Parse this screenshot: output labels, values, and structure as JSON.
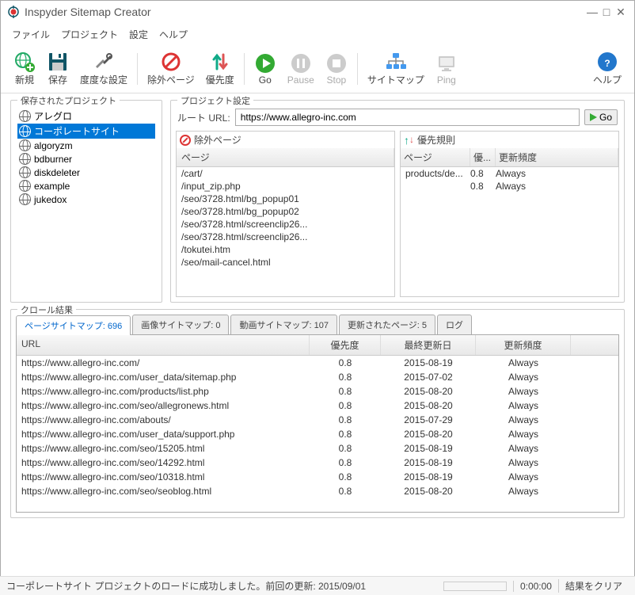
{
  "title": "Inspyder Sitemap Creator",
  "menu": {
    "file": "ファイル",
    "project": "プロジェクト",
    "settings": "設定",
    "help": "ヘルプ"
  },
  "toolbar": {
    "new": "新規",
    "save": "保存",
    "adv": "度度な設定",
    "excl": "除外ページ",
    "prio": "優先度",
    "go": "Go",
    "pause": "Pause",
    "stop": "Stop",
    "sitemap": "サイトマップ",
    "ping": "Ping",
    "help": "ヘルプ"
  },
  "saved_projects": {
    "legend": "保存されたプロジェクト",
    "items": [
      "アレグロ",
      "コーポレートサイト",
      "algoryzm",
      "bdburner",
      "diskdeleter",
      "example",
      "jukedox"
    ],
    "selected": 1
  },
  "project_settings": {
    "legend": "プロジェクト設定",
    "root_label": "ルート URL:",
    "root_url": "https://www.allegro-inc.com",
    "go": "Go",
    "excluded": {
      "title": "除外ページ",
      "col": "ページ",
      "items": [
        "/cart/",
        "/input_zip.php",
        "/seo/3728.html/bg_popup01",
        "/seo/3728.html/bg_popup02",
        "/seo/3728.html/screenclip26...",
        "/seo/3728.html/screenclip26...",
        "/tokutei.htm",
        "/seo/mail-cancel.html"
      ]
    },
    "priority": {
      "title": "優先規則",
      "cols": {
        "page": "ページ",
        "pri": "優...",
        "freq": "更新頻度"
      },
      "rows": [
        {
          "page": "products/de...",
          "pri": "0.8",
          "freq": "Always"
        },
        {
          "page": "",
          "pri": "0.8",
          "freq": "Always"
        }
      ]
    }
  },
  "crawl": {
    "legend": "クロール結果",
    "tabs": {
      "t1": "ページサイトマップ: 696",
      "t2": "画像サイトマップ: 0",
      "t3": "動画サイトマップ: 107",
      "t4": "更新されたページ: 5",
      "t5": "ログ"
    },
    "cols": {
      "url": "URL",
      "pri": "優先度",
      "date": "最終更新日",
      "freq": "更新頻度"
    },
    "rows": [
      {
        "url": "https://www.allegro-inc.com/",
        "pri": "0.8",
        "date": "2015-08-19",
        "freq": "Always"
      },
      {
        "url": "https://www.allegro-inc.com/user_data/sitemap.php",
        "pri": "0.8",
        "date": "2015-07-02",
        "freq": "Always"
      },
      {
        "url": "https://www.allegro-inc.com/products/list.php",
        "pri": "0.8",
        "date": "2015-08-20",
        "freq": "Always"
      },
      {
        "url": "https://www.allegro-inc.com/seo/allegronews.html",
        "pri": "0.8",
        "date": "2015-08-20",
        "freq": "Always"
      },
      {
        "url": "https://www.allegro-inc.com/abouts/",
        "pri": "0.8",
        "date": "2015-07-29",
        "freq": "Always"
      },
      {
        "url": "https://www.allegro-inc.com/user_data/support.php",
        "pri": "0.8",
        "date": "2015-08-20",
        "freq": "Always"
      },
      {
        "url": "https://www.allegro-inc.com/seo/15205.html",
        "pri": "0.8",
        "date": "2015-08-19",
        "freq": "Always"
      },
      {
        "url": "https://www.allegro-inc.com/seo/14292.html",
        "pri": "0.8",
        "date": "2015-08-19",
        "freq": "Always"
      },
      {
        "url": "https://www.allegro-inc.com/seo/10318.html",
        "pri": "0.8",
        "date": "2015-08-19",
        "freq": "Always"
      },
      {
        "url": "https://www.allegro-inc.com/seo/seoblog.html",
        "pri": "0.8",
        "date": "2015-08-20",
        "freq": "Always"
      }
    ]
  },
  "status": {
    "msg": "コーポレートサイト プロジェクトのロードに成功しました。前回の更新: 2015/09/01",
    "time": "0:00:00",
    "clear": "結果をクリア"
  }
}
